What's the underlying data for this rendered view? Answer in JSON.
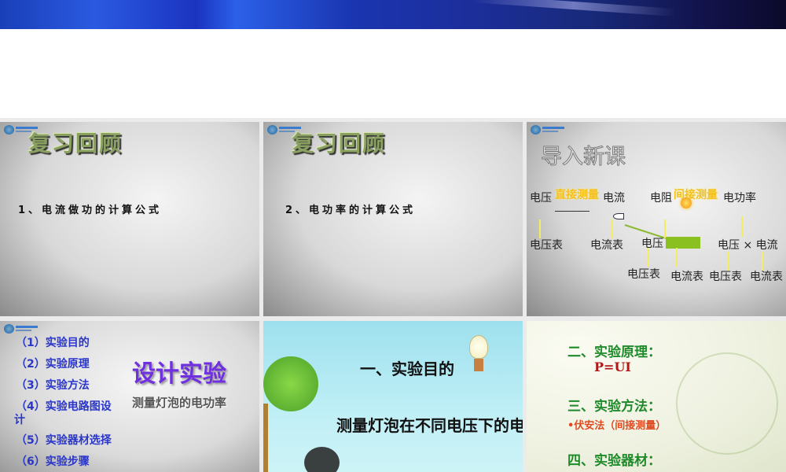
{
  "slides": [
    {
      "title": "复习回顾",
      "item": "1、电流做功的计算公式"
    },
    {
      "title": "复习回顾",
      "item": "2、电功率的计算公式"
    },
    {
      "title": "导入新课",
      "top_row": [
        "电压",
        "直接测量",
        "电流",
        "电阻",
        "间接测量",
        "电功率"
      ],
      "mid_row": [
        "电压表",
        "电流表",
        "电压",
        "电压 × 电流"
      ],
      "bottom_row": [
        "电压表",
        "电流表",
        "电压表",
        "电流表"
      ]
    },
    {
      "title": "设计实验",
      "subtitle": "测量灯泡的电功率",
      "items": [
        "（1）实验目的",
        "（2）实验原理",
        "（3）实验方法",
        "（4）实验电路图设",
        "计",
        "（5）实验器材选择",
        "（6）实验步骤"
      ]
    },
    {
      "heading": "一、实验目的",
      "body": "测量灯泡在不同电压下的电功"
    },
    {
      "principle": "二、实验原理：",
      "formula": "P=UI",
      "method": "三、实验方法：",
      "method_item": "•伏安法（间接测量）",
      "equipment": "四、实验器材："
    }
  ],
  "colors": {
    "banner": "#1b34c0",
    "list_blue": "#2a36c8",
    "green": "#1e8a2a",
    "red": "#e04a20"
  }
}
